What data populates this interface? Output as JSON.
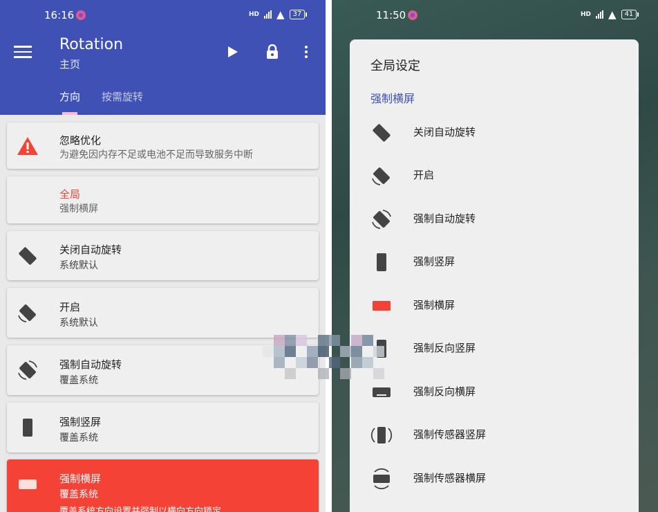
{
  "left_status": {
    "time": "16:16",
    "signal": "HD",
    "battery": "37"
  },
  "right_status": {
    "time": "11:50",
    "signal": "HD",
    "battery": "41"
  },
  "appbar": {
    "title": "Rotation",
    "subtitle": "主页"
  },
  "tabs": [
    {
      "label": "方向"
    },
    {
      "label": "按需旋转"
    }
  ],
  "cards": [
    {
      "title": "忽略优化",
      "sub": "为避免因内存不足或电池不足而导致服务中断",
      "icon": "warning-icon"
    },
    {
      "title": "全局",
      "sub": "强制横屏"
    },
    {
      "title": "关闭自动旋转",
      "sub": "系统默认",
      "icon": "rotation-off-icon"
    },
    {
      "title": "开启",
      "sub": "系统默认",
      "icon": "rotation-on-icon"
    },
    {
      "title": "强制自动旋转",
      "sub": "覆盖系统",
      "icon": "force-auto-rotate-icon"
    },
    {
      "title": "强制竖屏",
      "sub": "覆盖系统",
      "icon": "portrait-icon"
    },
    {
      "title": "强制横屏",
      "sub": "覆盖系统",
      "desc": "覆盖系统方向设置并强制以横向方向锁定",
      "icon": "landscape-icon"
    }
  ],
  "sheet": {
    "title": "全局设定",
    "section": "强制横屏",
    "options": [
      {
        "label": "关闭自动旋转",
        "icon": "rotation-off-icon"
      },
      {
        "label": "开启",
        "icon": "rotation-on-icon"
      },
      {
        "label": "强制自动旋转",
        "icon": "force-auto-rotate-icon"
      },
      {
        "label": "强制竖屏",
        "icon": "portrait-icon"
      },
      {
        "label": "强制横屏",
        "icon": "landscape-icon"
      },
      {
        "label": "强制反向竖屏",
        "icon": "reverse-portrait-icon"
      },
      {
        "label": "强制反向横屏",
        "icon": "reverse-landscape-icon"
      },
      {
        "label": "强制传感器竖屏",
        "icon": "sensor-portrait-icon"
      },
      {
        "label": "强制传感器横屏",
        "icon": "sensor-landscape-icon"
      }
    ]
  },
  "colors": {
    "primary": "#3f51b5",
    "accent": "#f44336",
    "tab_indicator": "#f8bbd0"
  }
}
